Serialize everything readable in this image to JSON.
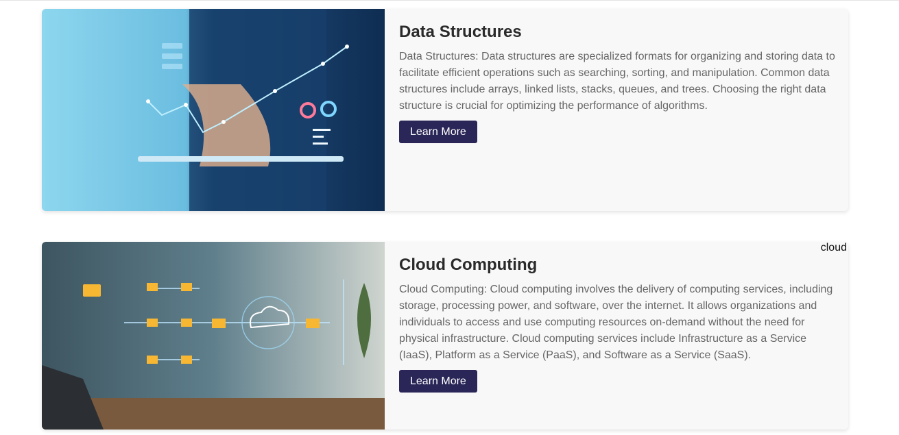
{
  "cards": [
    {
      "title": "Data Structures",
      "description": "Data Structures: Data structures are specialized formats for organizing and storing data to facilitate efficient operations such as searching, sorting, and manipulation. Common data structures include arrays, linked lists, stacks, queues, and trees. Choosing the right data structure is crucial for optimizing the performance of algorithms.",
      "button_label": "Learn More",
      "image": "hand-tablet-analytics-photo"
    },
    {
      "title": "Cloud Computing",
      "description": "Cloud Computing: Cloud computing involves the delivery of computing services, including storage, processing power, and software, over the internet. It allows organizations and individuals to access and use computing resources on-demand without the need for physical infrastructure. Cloud computing services include Infrastructure as a Service (IaaS), Platform as a Service (PaaS), and Software as a Service (SaaS).",
      "button_label": "Learn More",
      "image": "cloud-network-folders-photo",
      "tag": "cloud"
    }
  ],
  "colors": {
    "button": "#2a2658",
    "card_bg": "#f8f8f8"
  }
}
